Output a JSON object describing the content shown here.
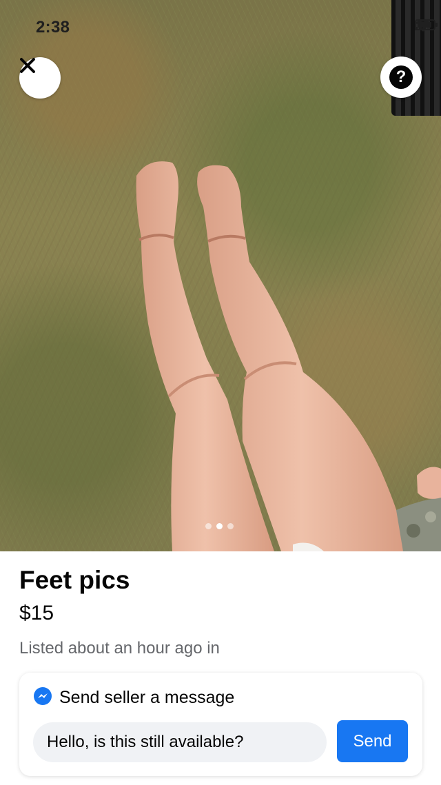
{
  "status_bar": {
    "time": "2:38"
  },
  "photo": {
    "current_index": 2,
    "total_images": 3
  },
  "listing": {
    "title": "Feet pics",
    "price": "$15",
    "listed": "Listed about an hour ago in"
  },
  "message": {
    "header_label": "Send seller a message",
    "input_value": "Hello, is this still available?",
    "send_label": "Send"
  },
  "icons": {
    "close": "close-icon",
    "help": "question-mark-icon",
    "messenger": "messenger-icon"
  },
  "colors": {
    "accent": "#1877f2",
    "secondary_text": "#65676b"
  }
}
